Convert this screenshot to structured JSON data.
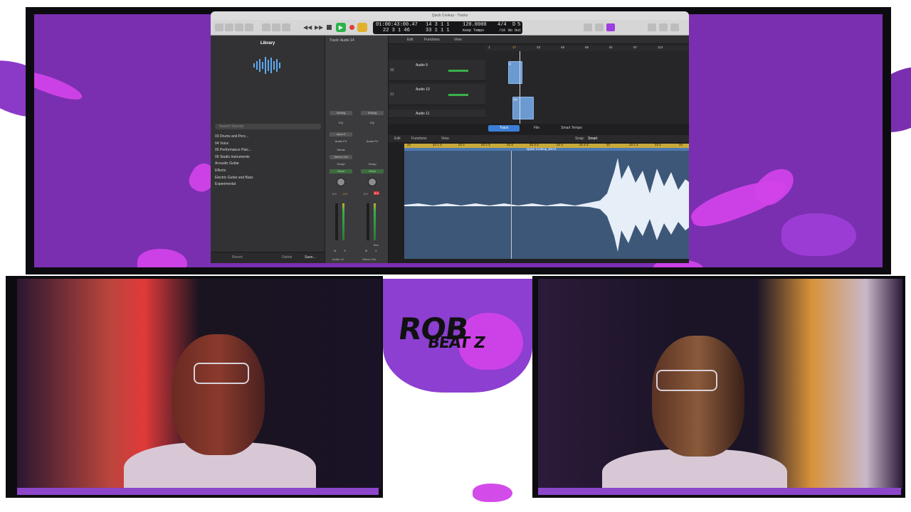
{
  "window": {
    "title": "Quick Cookup - Tracks"
  },
  "lcd": {
    "time_top": "01:00:43:00.47",
    "time_bottom": "22  3  1   46",
    "bars_top": "14  3  1     1",
    "bars_bottom": "33  1  1     1",
    "tempo": "120.0000",
    "tempo_label": "Keep Tempo",
    "signature": "4/4",
    "signature_sub": "/16",
    "key": "D",
    "key_value": "5",
    "key_sub": "No Out"
  },
  "library": {
    "title": "Library",
    "search_placeholder": "Search Sounds",
    "items": [
      "03 Drums and Perc...",
      "04 Voice",
      "05 Performance Patc...",
      "06 Studio Instruments",
      "Acoustic Guitar",
      "Effects",
      "Electric Guitar and Bass",
      "Experimental"
    ],
    "revert_label": "Revert",
    "delete_label": "Delete",
    "save_label": "Save..."
  },
  "inspector": {
    "track_label": "Track:",
    "track_name": "Audio 14",
    "strip1": {
      "setting": "Setting",
      "eq": "EQ",
      "input": "Input 2",
      "audiofx": "Audio FX",
      "sends": "Sends",
      "output": "Stereo Out",
      "group": "Group",
      "automation": "Read",
      "vol": "0.0",
      "peak": "-0.0",
      "mute": "M",
      "solo": "S",
      "name": "Audio 14"
    },
    "strip2": {
      "setting": "Setting",
      "eq": "EQ",
      "audiofx": "Audio FX",
      "group": "Group",
      "automation": "Read",
      "vol": "0.0",
      "peak": "6.6",
      "mute": "M",
      "solo": "S",
      "bounce": "Bnc",
      "name": "Stereo Out"
    }
  },
  "tracks_area": {
    "menus": [
      "Edit",
      "Functions",
      "View"
    ],
    "ruler_ticks": [
      "1",
      "17",
      "33",
      "49",
      "65",
      "81",
      "97",
      "113"
    ],
    "rows": [
      {
        "num": "30",
        "name": "Audio 9",
        "buttons": [
          "M",
          "S",
          "R",
          "I"
        ]
      },
      {
        "num": "31",
        "name": "Audio 10",
        "buttons": [
          "M",
          "S",
          "R",
          "I"
        ]
      },
      {
        "num": "",
        "name": "Audio 11",
        "buttons": []
      }
    ],
    "region_labels": [
      "Q",
      "Qui",
      "Qui"
    ]
  },
  "editor": {
    "tabs": [
      "Track",
      "File",
      "Smart Tempo"
    ],
    "menus": [
      "Edit",
      "Functions",
      "View"
    ],
    "snap_label": "Snap:",
    "snap_value": "Smart",
    "region_name": "Quick Cookup_Bnc3",
    "ruler_ticks": [
      "22",
      "22 1 3",
      "22 2",
      "22 2 3",
      "22 3",
      "22 3 3",
      "22 4",
      "22 4 3",
      "23",
      "23 1 3",
      "23 2",
      "23"
    ]
  },
  "overlay": {
    "logo_line1": "ROB",
    "logo_line2": "BEAT Z"
  },
  "colors": {
    "overlay_purple": "#7a2fb0",
    "accent_pink": "#d142e8",
    "waveform_bg": "#3d5778",
    "ruler_gold": "#c8a93a",
    "play_green": "#2cb24a",
    "record_red": "#e23b3b"
  }
}
